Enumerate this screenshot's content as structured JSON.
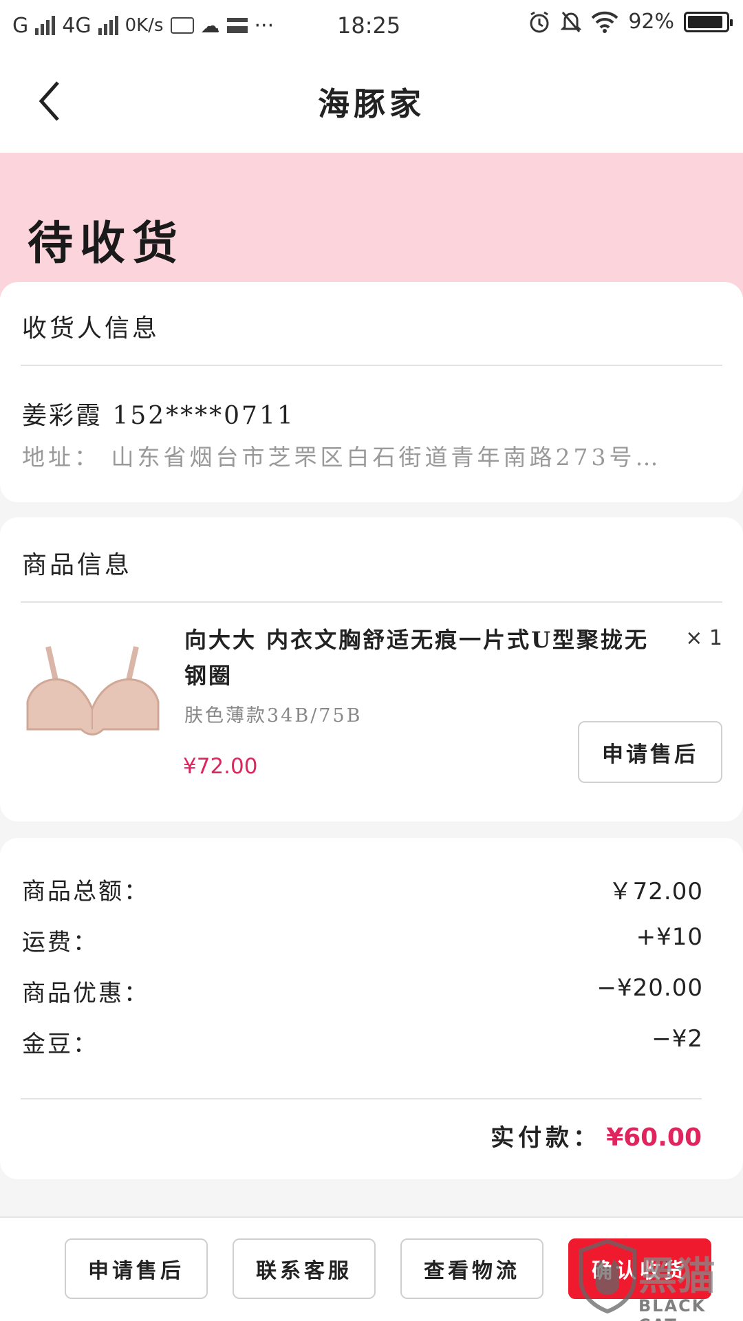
{
  "status_bar": {
    "carrier": "G",
    "network": "4G",
    "speed": "0K/s",
    "time": "18:25",
    "battery": "92%"
  },
  "nav": {
    "title": "海豚家"
  },
  "banner": {
    "status": "待收货"
  },
  "recipient": {
    "header": "收货人信息",
    "name_phone": "姜彩霞 152****0711",
    "address": "地址： 山东省烟台市芝罘区白石街道青年南路273号…"
  },
  "product": {
    "header": "商品信息",
    "title": "向大大 内衣文胸舒适无痕一片式U型聚拢无钢圈",
    "quantity": "× 1",
    "variant": "肤色薄款34B/75B",
    "price": "¥72.00",
    "after_sale_label": "申请售后"
  },
  "summary": {
    "rows": [
      {
        "label": "商品总额：",
        "value": "￥72.00"
      },
      {
        "label": "运费：",
        "value": "+¥10"
      },
      {
        "label": "商品优惠：",
        "value": "−¥20.00"
      },
      {
        "label": "金豆：",
        "value": "−¥2"
      }
    ],
    "total_label": "实付款：",
    "total_value": "¥60.00"
  },
  "bottom_bar": {
    "buttons": [
      {
        "label": "申请售后"
      },
      {
        "label": "联系客服"
      },
      {
        "label": "查看物流"
      },
      {
        "label": "确认收货"
      }
    ]
  },
  "watermark": {
    "cn": "黑猫",
    "en": "BLACK CAT"
  },
  "colors": {
    "banner_bg": "#fbd4dc",
    "price_accent": "#e0245e",
    "confirm_button": "#f01a2e"
  }
}
